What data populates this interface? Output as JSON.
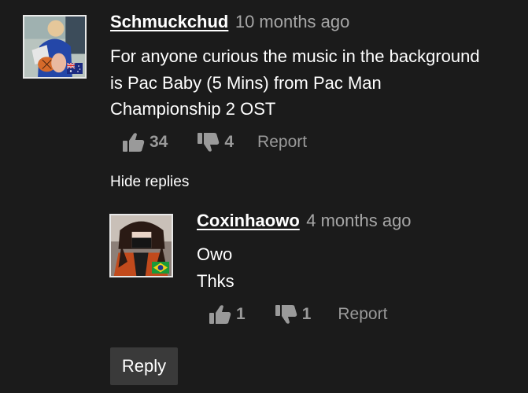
{
  "comment": {
    "username": "Schmuckchud",
    "timestamp": "10 months ago",
    "body": [
      "For anyone curious the music in the background",
      "is Pac Baby (5 Mins) from Pac Man",
      "Championship 2 OST"
    ],
    "likes": "34",
    "dislikes": "4",
    "report_label": "Report"
  },
  "hide_replies_label": "Hide replies",
  "reply": {
    "username": "Coxinhaowo",
    "timestamp": "4 months ago",
    "body": [
      "Owo",
      "Thks"
    ],
    "likes": "1",
    "dislikes": "1",
    "report_label": "Report"
  },
  "reply_button_label": "Reply",
  "icons": {
    "like": "thumbs-up-icon",
    "dislike": "thumbs-down-icon",
    "flag_australia": "australia-flag-icon",
    "flag_brazil": "brazil-flag-icon"
  },
  "colors": {
    "background": "#1b1b1b",
    "muted_text": "#9a9a9a",
    "timestamp_text": "#a6a6a6",
    "button_bg": "#3a3a3a"
  }
}
